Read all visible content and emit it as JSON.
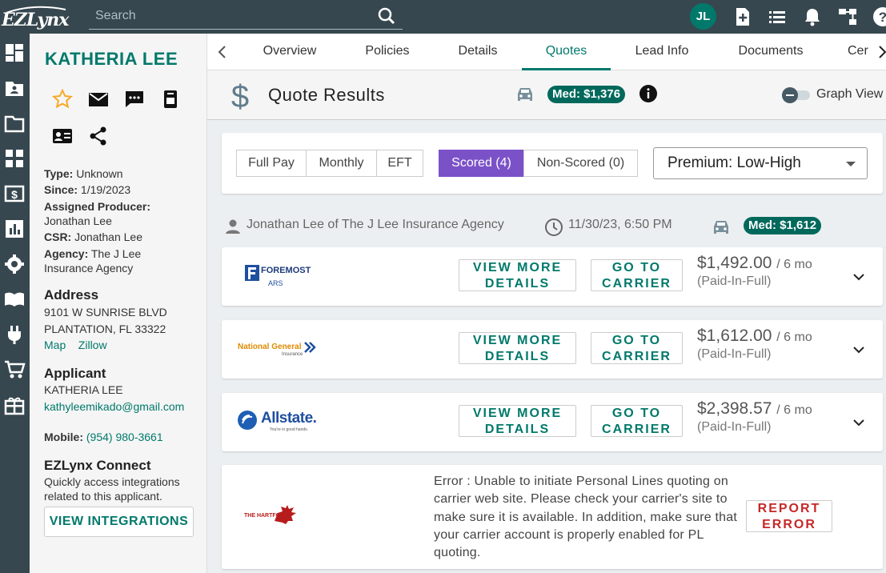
{
  "topbar": {
    "logo_text": "EZLynx",
    "search_placeholder": "Search",
    "avatar_initials": "JL"
  },
  "applicant_panel": {
    "name": "KATHERIA LEE",
    "type_label": "Type:",
    "type_value": "Unknown",
    "since_label": "Since:",
    "since_value": "1/19/2023",
    "producer_label": "Assigned Producer:",
    "producer_value": "Jonathan Lee",
    "csr_label": "CSR:",
    "csr_value": "Jonathan Lee",
    "agency_label": "Agency:",
    "agency_value": "The J Lee Insurance Agency",
    "address_title": "Address",
    "address_line1": "9101 W SUNRISE BLVD",
    "address_line2": "PLANTATION, FL 33322",
    "map_link": "Map",
    "zillow_link": "Zillow",
    "applicant_title": "Applicant",
    "applicant_name": "KATHERIA LEE",
    "email": "kathyleemikado@gmail.com",
    "mobile_label": "Mobile:",
    "mobile_value": "(954) 980-3661",
    "connect_title": "EZLynx Connect",
    "connect_desc": "Quickly access integrations related to this applicant.",
    "integrations_button": "VIEW INTEGRATIONS"
  },
  "tabs": [
    "Overview",
    "Policies",
    "Details",
    "Quotes",
    "Lead Info",
    "Documents",
    "Cer"
  ],
  "active_tab": "Quotes",
  "quote_results": {
    "title": "Quote Results",
    "median_pill": "Med: $1,376",
    "graph_view_label": "Graph View"
  },
  "filters": {
    "payment": [
      "Full Pay",
      "Monthly",
      "EFT"
    ],
    "scored": "Scored (4)",
    "non_scored": "Non-Scored (0)",
    "sort_value": "Premium: Low-High"
  },
  "quote_meta": {
    "producer": "Jonathan Lee of The J Lee Insurance Agency",
    "timestamp": "11/30/23, 6:50 PM",
    "median_pill": "Med: $1,612"
  },
  "quotes": [
    {
      "carrier_logo": "FOREMOST",
      "carrier_sub": "ARS",
      "view_btn": "VIEW MORE DETAILS",
      "carrier_btn": "GO TO CARRIER",
      "price": "$1,492.00",
      "term": "/ 6 mo",
      "note": "(Paid-In-Full)"
    },
    {
      "carrier_logo": "National General",
      "carrier_sub": "Insurance",
      "view_btn": "VIEW MORE DETAILS",
      "carrier_btn": "GO TO CARRIER",
      "price": "$1,612.00",
      "term": "/ 6 mo",
      "note": "(Paid-In-Full)"
    },
    {
      "carrier_logo": "Allstate.",
      "carrier_sub": "You're in good hands.",
      "view_btn": "VIEW MORE DETAILS",
      "carrier_btn": "GO TO CARRIER",
      "price": "$2,398.57",
      "term": "/ 6 mo",
      "note": "(Paid-In-Full)"
    }
  ],
  "error_quote": {
    "carrier_logo": "THE HARTFORD",
    "message": "Error : Unable to initiate Personal Lines quoting on carrier web site. Please check your carrier's site to make sure it is available. In addition, make sure that your carrier account is properly enabled for PL quoting.",
    "report_btn": "REPORT ERROR"
  },
  "colors": {
    "accent": "#00796b",
    "dark_bar": "#37474f",
    "scored_purple": "#7b51c8",
    "error_red": "#c62828"
  }
}
